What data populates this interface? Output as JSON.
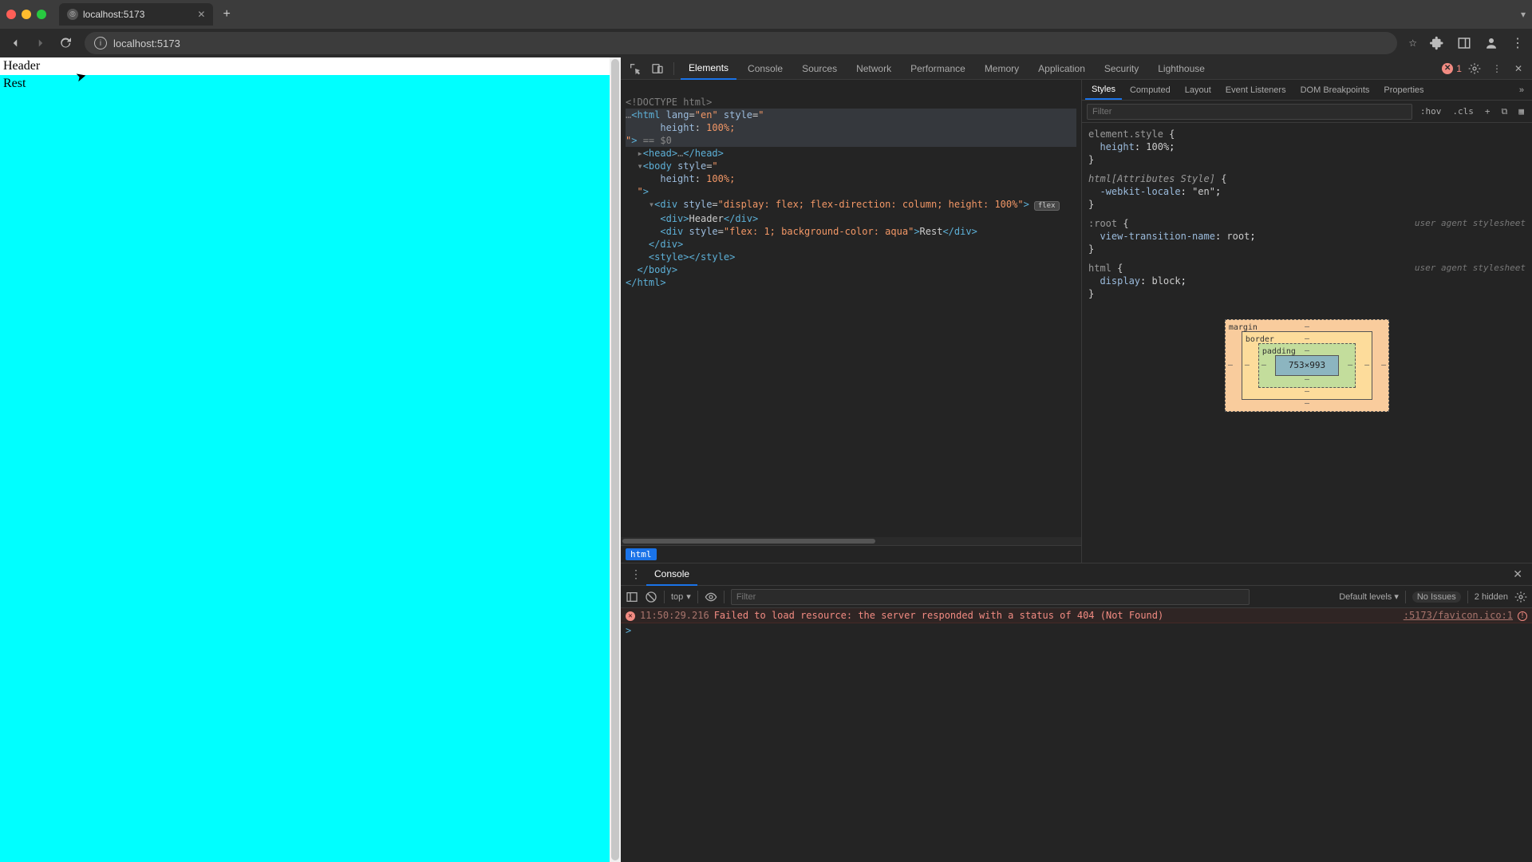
{
  "window": {
    "tab_title": "localhost:5173",
    "address": "localhost:5173"
  },
  "page": {
    "header_text": "Header",
    "rest_text": "Rest"
  },
  "devtools": {
    "tabs": [
      "Elements",
      "Console",
      "Sources",
      "Network",
      "Performance",
      "Memory",
      "Application",
      "Security",
      "Lighthouse"
    ],
    "active_tab": "Elements",
    "error_count": "1",
    "dom": {
      "doctype": "<!DOCTYPE html>",
      "html_open": "html",
      "html_lang": "en",
      "html_style_attr": "style",
      "head_collapsed": "head",
      "body_tag": "body",
      "body_style_attr": "style",
      "height_prop": "height",
      "height_val": "100%",
      "eq_s0": "== $0",
      "div_tag": "div",
      "outer_style_attr": "style",
      "outer_style_val": "display: flex; flex-direction: column; height: 100%",
      "flex_badge": "flex",
      "header_div_text": "Header",
      "rest_style_attr": "style",
      "rest_style_val": "flex: 1; background-color: aqua",
      "rest_div_text": "Rest",
      "style_tag": "style",
      "breadcrumb": "html"
    },
    "styles": {
      "sub_tabs": [
        "Styles",
        "Computed",
        "Layout",
        "Event Listeners",
        "DOM Breakpoints",
        "Properties"
      ],
      "active_sub": "Styles",
      "filter_placeholder": "Filter",
      "hov": ":hov",
      "cls": ".cls",
      "rule1_sel": "element.style",
      "rule1_prop": "height",
      "rule1_val": "100%",
      "rule2_sel": "html[Attributes Style]",
      "rule2_prop": "-webkit-locale",
      "rule2_val": "\"en\"",
      "rule3_sel": ":root",
      "rule3_uas": "user agent stylesheet",
      "rule3_prop": "view-transition-name",
      "rule3_val": "root",
      "rule4_sel": "html",
      "rule4_uas": "user agent stylesheet",
      "rule4_prop": "display",
      "rule4_val": "block",
      "box": {
        "margin_label": "margin",
        "border_label": "border",
        "padding_label": "padding",
        "content": "753×993",
        "dash": "–"
      }
    }
  },
  "drawer": {
    "title": "Console",
    "context": "top",
    "filter_placeholder": "Filter",
    "levels": "Default levels",
    "no_issues": "No Issues",
    "hidden": "2 hidden",
    "error": {
      "time": "11:50:29.216",
      "msg": "Failed to load resource: the server responded with a status of 404 (Not Found)",
      "src": ":5173/favicon.ico:1"
    },
    "prompt": ">"
  }
}
